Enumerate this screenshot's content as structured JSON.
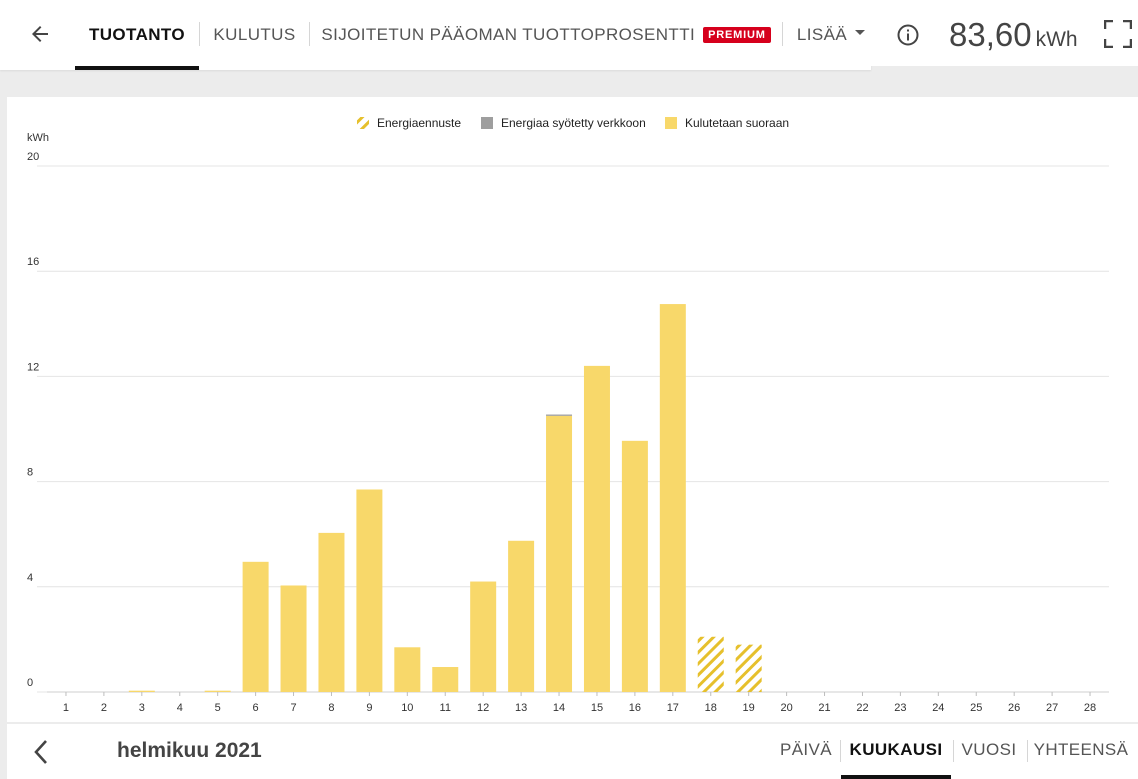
{
  "tabs": [
    {
      "label": "TUOTANTO",
      "active": true
    },
    {
      "label": "KULUTUS",
      "active": false
    },
    {
      "label": "SIJOITETUN PÄÄOMAN TUOTTOPROSENTTI",
      "active": false,
      "badge": "PREMIUM"
    },
    {
      "label": "LISÄÄ",
      "active": false,
      "dropdown": true
    }
  ],
  "header": {
    "total_value": "83,60",
    "total_unit": "kWh",
    "icons": [
      "back-arrow-icon",
      "info-icon",
      "fullscreen-icon"
    ]
  },
  "colors": {
    "bar": "#f8d86a",
    "forecast": "#e6c02c",
    "grid_feed": "#9e9e9e",
    "premium": "#d6001c"
  },
  "chart_data": {
    "type": "bar",
    "stacked": true,
    "ylabel": "kWh",
    "ylim": [
      0,
      20
    ],
    "yticks": [
      0,
      4,
      8,
      12,
      16,
      20
    ],
    "legend_position": "top-center",
    "legend": [
      {
        "name": "Energiaennuste",
        "style": "hatched"
      },
      {
        "name": "Energiaa syötetty verkkoon",
        "style": "solid-gray"
      },
      {
        "name": "Kulutetaan suoraan",
        "style": "solid-yellow"
      }
    ],
    "categories": [
      "1",
      "2",
      "3",
      "4",
      "5",
      "6",
      "7",
      "8",
      "9",
      "10",
      "11",
      "12",
      "13",
      "14",
      "15",
      "16",
      "17",
      "18",
      "19",
      "20",
      "21",
      "22",
      "23",
      "24",
      "25",
      "26",
      "27",
      "28"
    ],
    "series": [
      {
        "name": "Kulutetaan suoraan",
        "values": [
          0,
          0,
          0.05,
          0,
          0.05,
          4.95,
          4.05,
          6.05,
          7.7,
          1.7,
          0.95,
          4.2,
          5.75,
          10.5,
          12.4,
          9.55,
          14.75,
          0,
          0,
          0,
          0,
          0,
          0,
          0,
          0,
          0,
          0,
          0
        ]
      },
      {
        "name": "Energiaa syötetty verkkoon",
        "values": [
          0,
          0,
          0,
          0,
          0,
          0,
          0,
          0,
          0,
          0,
          0,
          0,
          0,
          0.05,
          0,
          0,
          0,
          0,
          0,
          0,
          0,
          0,
          0,
          0,
          0,
          0,
          0,
          0
        ]
      },
      {
        "name": "Energiaennuste",
        "values": [
          0,
          0,
          0,
          0,
          0,
          0,
          0,
          0,
          0,
          0,
          0,
          0,
          0,
          0,
          0,
          0,
          0,
          2.1,
          1.8,
          0,
          0,
          0,
          0,
          0,
          0,
          0,
          0,
          0
        ]
      }
    ]
  },
  "footer": {
    "period": "helmikuu 2021",
    "period_tabs": [
      {
        "label": "PÄIVÄ",
        "active": false
      },
      {
        "label": "KUUKAUSI",
        "active": true
      },
      {
        "label": "VUOSI",
        "active": false
      },
      {
        "label": "YHTEENSÄ",
        "active": false
      }
    ]
  }
}
